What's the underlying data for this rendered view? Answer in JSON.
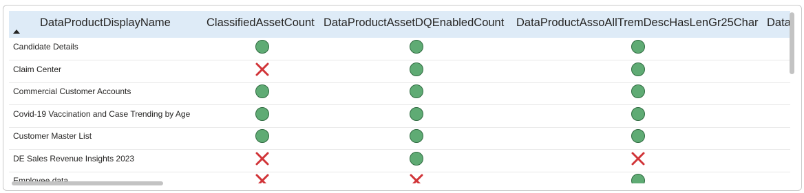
{
  "table": {
    "columns": [
      {
        "label": "DataProductDisplayName"
      },
      {
        "label": "ClassifiedAssetCount"
      },
      {
        "label": "DataProductAssetDQEnabledCount"
      },
      {
        "label": "DataProductAssoAllTremDescHasLenGr25Char"
      },
      {
        "label": "Data"
      }
    ],
    "sort": {
      "column": "DataProductDisplayName",
      "direction": "ascending"
    },
    "status_icons": {
      "pass": "green-circle-icon",
      "fail": "red-x-icon"
    },
    "colors": {
      "header_bg": "#deebf7",
      "pass": "#5fab74",
      "fail": "#d13438"
    },
    "rows": [
      {
        "name": "Candidate Details",
        "values": [
          "pass",
          "pass",
          "pass"
        ]
      },
      {
        "name": "Claim Center",
        "values": [
          "fail",
          "pass",
          "pass"
        ]
      },
      {
        "name": "Commercial Customer Accounts",
        "values": [
          "pass",
          "pass",
          "pass"
        ]
      },
      {
        "name": "Covid-19 Vaccination and Case Trending by Age",
        "values": [
          "pass",
          "pass",
          "pass"
        ]
      },
      {
        "name": "Customer Master List",
        "values": [
          "pass",
          "pass",
          "pass"
        ]
      },
      {
        "name": "DE Sales Revenue Insights 2023",
        "values": [
          "fail",
          "pass",
          "fail"
        ]
      },
      {
        "name": "Employee data",
        "values": [
          "fail",
          "fail",
          "pass"
        ]
      }
    ]
  }
}
